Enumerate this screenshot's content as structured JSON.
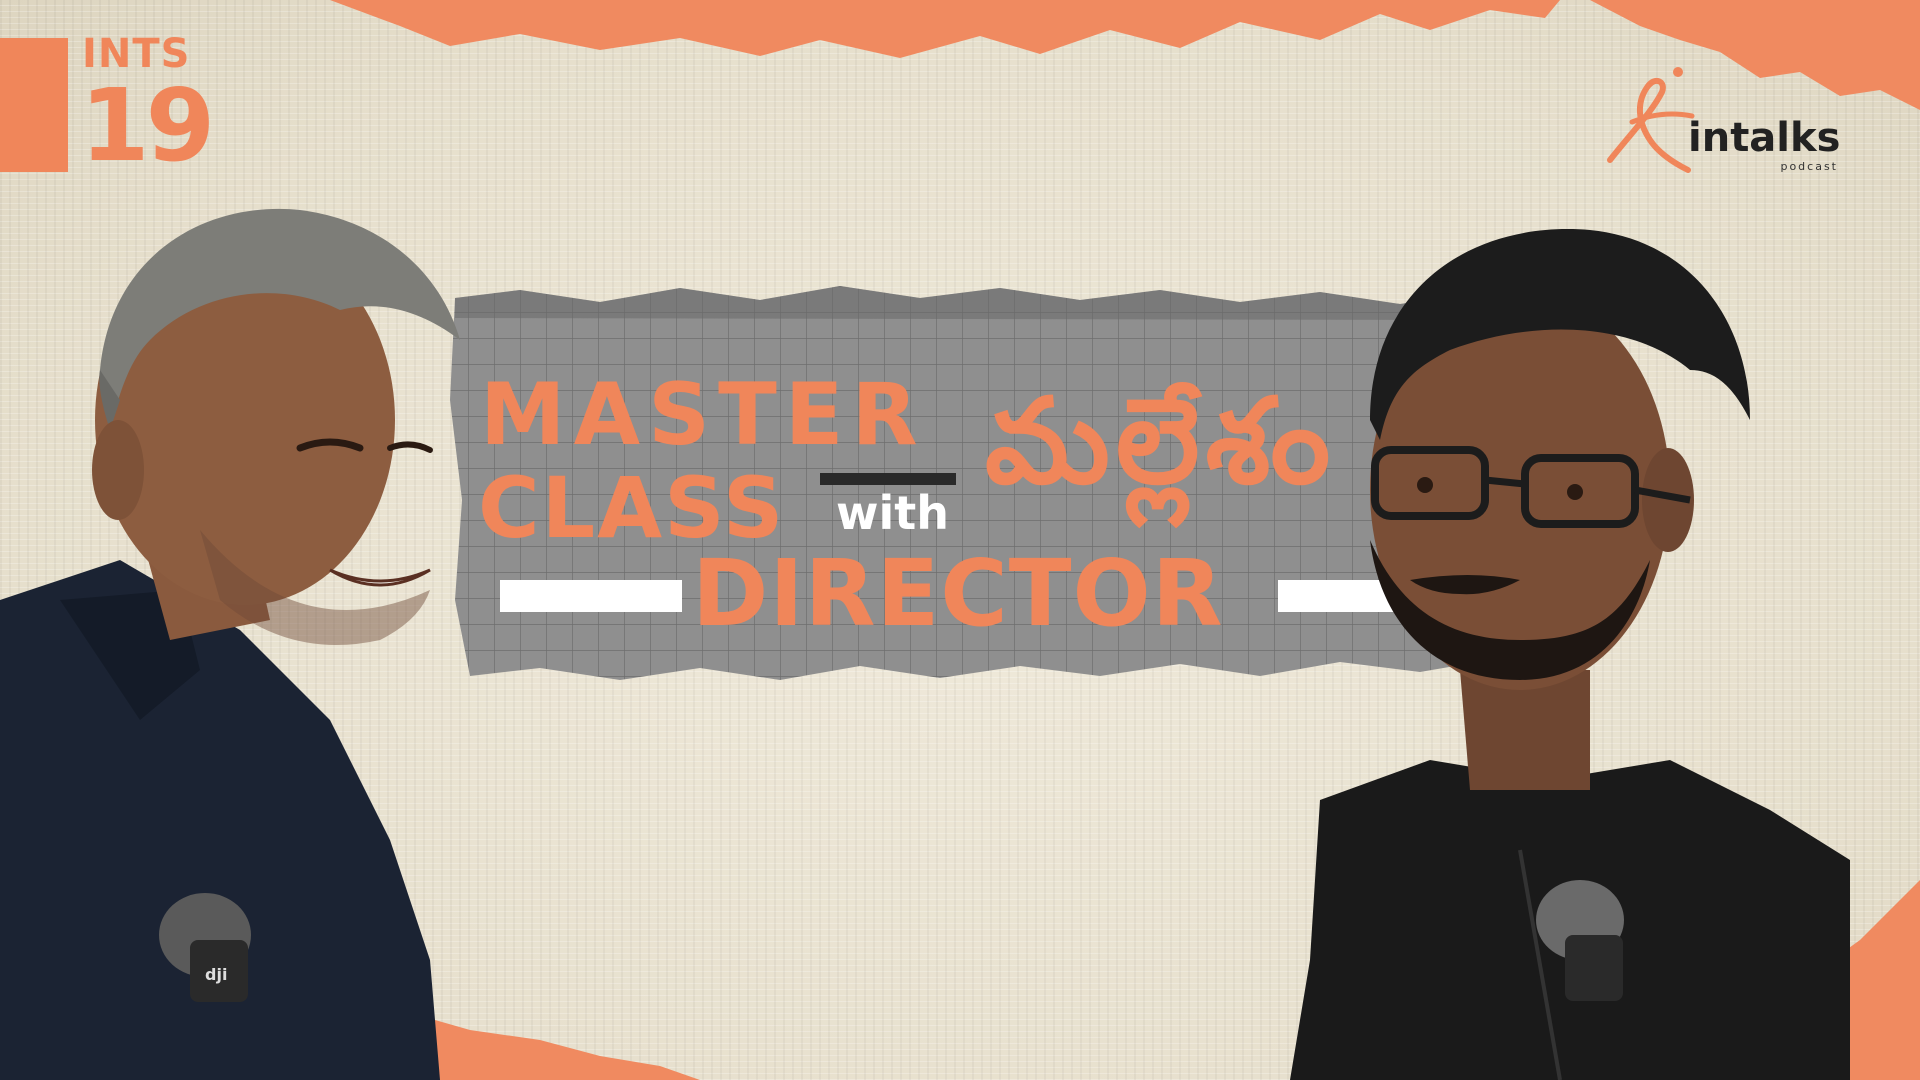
{
  "episode": {
    "label": "INTS",
    "number": "19"
  },
  "logo": {
    "wordmark": "intalks",
    "subtitle": "podcast"
  },
  "title": {
    "line1": "MASTER",
    "line2": "CLASS",
    "connector": "with",
    "line3": "DIRECTOR",
    "name_telugu": "మల్లేశం"
  },
  "mic_brand": "dji",
  "colors": {
    "accent": "#f0865a",
    "background": "#ece6d6",
    "banner_grey": "#8e8e8e",
    "shirt_left": "#1b2333",
    "shirt_right": "#1a1a1a"
  }
}
